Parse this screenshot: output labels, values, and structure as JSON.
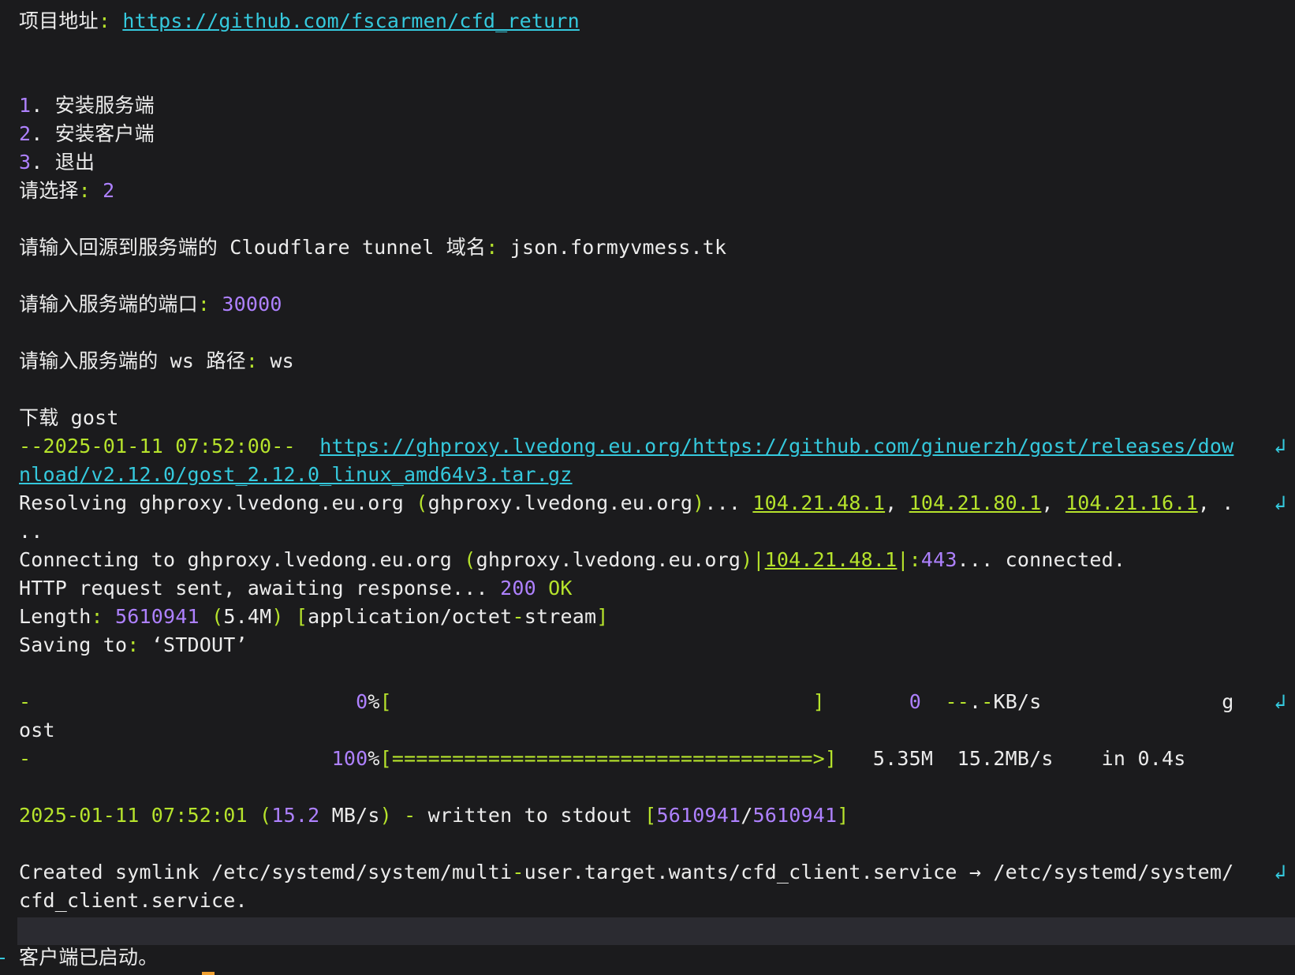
{
  "colors": {
    "background": "#1b1b1d",
    "text": "#ececec",
    "green": "#b6e32c",
    "purple": "#ae81ff",
    "cyan": "#35c9dd",
    "cursor": "#f0a030"
  },
  "icons": {
    "wrap": "line-wrap-arrow-icon"
  },
  "lines": [
    {
      "n": "project-url-line",
      "s": [
        [
          "w",
          "项目地址"
        ],
        [
          "g",
          ":"
        ],
        [
          "w",
          " "
        ],
        [
          "c",
          "https://github.com/fscarmen/cfd_return"
        ]
      ]
    },
    {
      "n": "menu-item-server",
      "s": [
        [
          "p",
          "1"
        ],
        [
          "w",
          ". 安装服务端"
        ]
      ]
    },
    {
      "n": "menu-item-client",
      "s": [
        [
          "p",
          "2"
        ],
        [
          "w",
          ". 安装客户端"
        ]
      ]
    },
    {
      "n": "menu-item-exit",
      "s": [
        [
          "p",
          "3"
        ],
        [
          "w",
          ". 退出"
        ]
      ]
    },
    {
      "n": "choice-prompt",
      "s": [
        [
          "w",
          "请选择"
        ],
        [
          "g",
          ":"
        ],
        [
          "w",
          " "
        ],
        [
          "p",
          "2"
        ]
      ]
    },
    {
      "n": "domain-prompt",
      "s": [
        [
          "w",
          "请输入回源到服务端的 Cloudflare tunnel 域名"
        ],
        [
          "g",
          ":"
        ],
        [
          "w",
          " json.formyvmess.tk"
        ]
      ]
    },
    {
      "n": "port-prompt",
      "s": [
        [
          "w",
          "请输入服务端的端口"
        ],
        [
          "g",
          ":"
        ],
        [
          "w",
          " "
        ],
        [
          "p",
          "30000"
        ]
      ]
    },
    {
      "n": "ws-path-prompt",
      "s": [
        [
          "w",
          "请输入服务端的 ws 路径"
        ],
        [
          "g",
          ":"
        ],
        [
          "w",
          " ws"
        ]
      ]
    },
    {
      "n": "download-gost",
      "s": [
        [
          "w",
          "下载 gost"
        ]
      ]
    },
    {
      "n": "wget-start",
      "s": [
        [
          "g",
          "--2025-01-11 07:52:00--"
        ],
        [
          "w",
          "  "
        ],
        [
          "c",
          "https://ghproxy.lvedong.eu.org/https://github.com/ginuerzh/gost/releases/dow"
        ]
      ],
      "wrap": true
    },
    {
      "n": "wget-url-cont",
      "s": [
        [
          "c",
          "nload/v2.12.0/gost_2.12.0_linux_amd64v3.tar.gz"
        ]
      ]
    },
    {
      "n": "resolving",
      "s": [
        [
          "w",
          "Resolving ghproxy.lvedong.eu.org "
        ],
        [
          "g",
          "("
        ],
        [
          "w",
          "ghproxy.lvedong.eu.org"
        ],
        [
          "g",
          ")"
        ],
        [
          "w",
          "... "
        ],
        [
          "gu",
          "104.21.48.1"
        ],
        [
          "w",
          ", "
        ],
        [
          "gu",
          "104.21.80.1"
        ],
        [
          "w",
          ", "
        ],
        [
          "gu",
          "104.21.16.1"
        ],
        [
          "w",
          ", ."
        ]
      ],
      "wrap": true
    },
    {
      "n": "resolving-cont",
      "s": [
        [
          "w",
          ".."
        ]
      ]
    },
    {
      "n": "connecting",
      "s": [
        [
          "w",
          "Connecting to ghproxy.lvedong.eu.org "
        ],
        [
          "g",
          "("
        ],
        [
          "w",
          "ghproxy.lvedong.eu.org"
        ],
        [
          "g",
          ")|"
        ],
        [
          "gu",
          "104.21.48.1"
        ],
        [
          "g",
          "|:"
        ],
        [
          "p",
          "443"
        ],
        [
          "w",
          "... connected."
        ]
      ]
    },
    {
      "n": "http-request",
      "s": [
        [
          "w",
          "HTTP request sent, awaiting response... "
        ],
        [
          "p",
          "200"
        ],
        [
          "g",
          " OK"
        ]
      ]
    },
    {
      "n": "length",
      "s": [
        [
          "w",
          "Length"
        ],
        [
          "g",
          ":"
        ],
        [
          "w",
          " "
        ],
        [
          "p",
          "5610941"
        ],
        [
          "w",
          " "
        ],
        [
          "g",
          "("
        ],
        [
          "w",
          "5.4M"
        ],
        [
          "g",
          ")"
        ],
        [
          "w",
          " "
        ],
        [
          "g",
          "["
        ],
        [
          "w",
          "application/octet"
        ],
        [
          "g",
          "-"
        ],
        [
          "w",
          "stream"
        ],
        [
          "g",
          "]"
        ]
      ]
    },
    {
      "n": "saving-to",
      "s": [
        [
          "w",
          "Saving to"
        ],
        [
          "g",
          ":"
        ],
        [
          "w",
          " ‘STDOUT’"
        ]
      ]
    },
    {
      "n": "progress-0",
      "s": [
        [
          "g",
          "-"
        ],
        [
          "w",
          "                           "
        ],
        [
          "p",
          "0"
        ],
        [
          "w",
          "%"
        ],
        [
          "g",
          "["
        ],
        [
          "w",
          "                                   "
        ],
        [
          "g",
          "]"
        ],
        [
          "w",
          "       "
        ],
        [
          "p",
          "0"
        ],
        [
          "w",
          "  "
        ],
        [
          "g",
          "--"
        ],
        [
          "w",
          "."
        ],
        [
          "g",
          "-"
        ],
        [
          "w",
          "KB/s               g"
        ]
      ],
      "wrap": true
    },
    {
      "n": "progress-cont",
      "s": [
        [
          "w",
          "ost"
        ]
      ]
    },
    {
      "n": "progress-100",
      "s": [
        [
          "g",
          "-"
        ],
        [
          "w",
          "                         "
        ],
        [
          "p",
          "100"
        ],
        [
          "w",
          "%"
        ],
        [
          "g",
          "[===================================>]"
        ],
        [
          "w",
          "   5.35M  15.2MB/s    in 0.4s"
        ]
      ]
    },
    {
      "n": "written-line",
      "s": [
        [
          "g",
          "2025-01-11 07:52:01"
        ],
        [
          "w",
          " "
        ],
        [
          "g",
          "("
        ],
        [
          "p",
          "15.2"
        ],
        [
          "w",
          " MB/s"
        ],
        [
          "g",
          ")"
        ],
        [
          "w",
          " "
        ],
        [
          "g",
          "-"
        ],
        [
          "w",
          " written to stdout "
        ],
        [
          "g",
          "["
        ],
        [
          "p",
          "5610941"
        ],
        [
          "w",
          "/"
        ],
        [
          "p",
          "5610941"
        ],
        [
          "g",
          "]"
        ]
      ]
    },
    {
      "n": "symlink-line",
      "s": [
        [
          "w",
          "Created symlink /etc/systemd/system/multi"
        ],
        [
          "g",
          "-"
        ],
        [
          "w",
          "user.target.wants/cfd_client.service → /etc/systemd/system/"
        ]
      ],
      "wrap": true
    },
    {
      "n": "symlink-cont",
      "s": [
        [
          "w",
          "cfd_client.service."
        ]
      ]
    },
    {
      "n": "client-started",
      "s": [
        [
          "w",
          "客户端已启动。"
        ]
      ]
    }
  ]
}
